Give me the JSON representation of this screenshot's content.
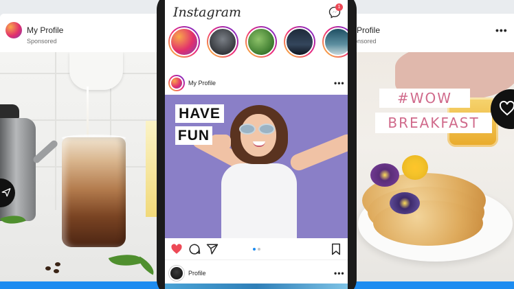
{
  "left_card": {
    "profile_name": "My Profile",
    "sponsored_label": "Sponsored"
  },
  "right_card": {
    "profile_name": "Profile",
    "sponsored_label": "onsored",
    "more_label": "•••",
    "overlay_line1": "#WOW",
    "overlay_line2": "BREAKFAST"
  },
  "phone": {
    "app_title": "Instagram",
    "notification_count": "1",
    "stories_count_visible": 5,
    "post": {
      "profile_name": "My Profile",
      "more_label": "•••",
      "overlay_line1": "HAVE",
      "overlay_line2": "FUN",
      "carousel_pages": 2,
      "carousel_active": 1
    },
    "next_post": {
      "profile_name": "Profile",
      "more_label": "•••"
    }
  },
  "colors": {
    "like_red": "#ed4956",
    "carousel_active": "#1d8cf0",
    "wow_pink": "#d06a8b",
    "strip_blue": "#1d8cf0"
  },
  "icons": [
    "send-icon",
    "heart-icon",
    "messenger-icon",
    "like-icon",
    "comment-icon",
    "share-icon",
    "bookmark-icon"
  ]
}
